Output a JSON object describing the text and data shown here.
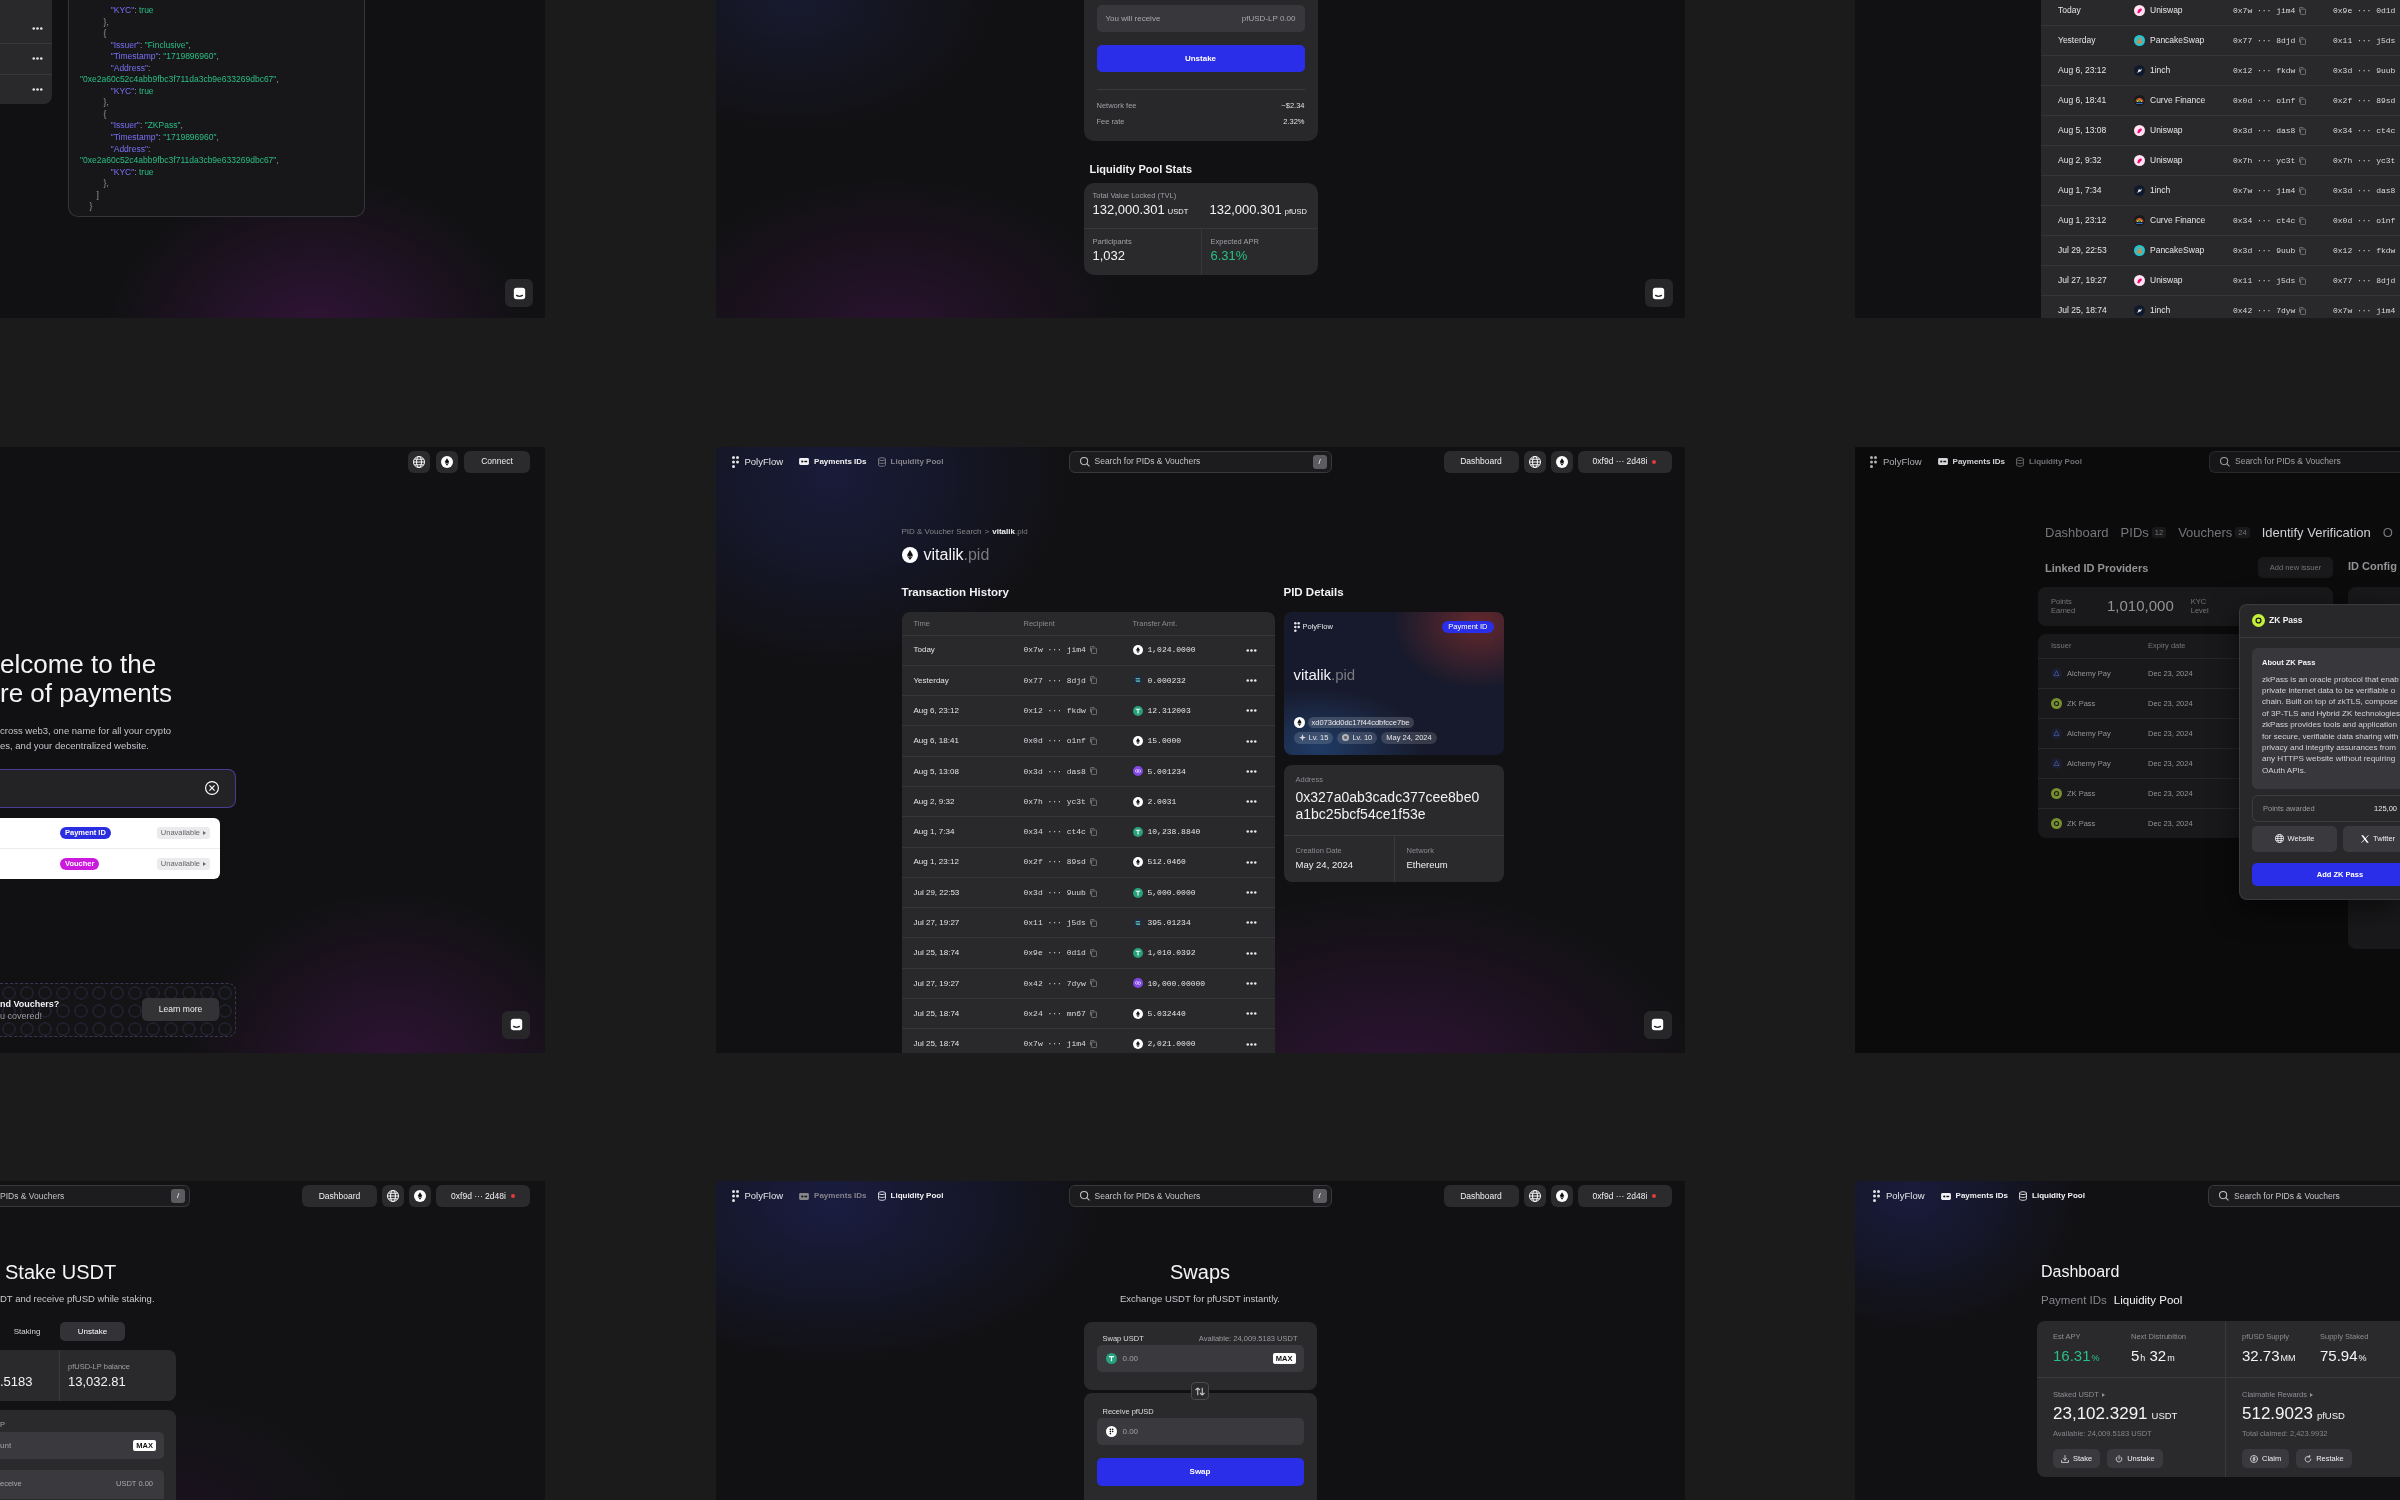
{
  "screens": [
    {
      "kind": "code-viewer",
      "code_lines": [
        "             \"KYC\": true",
        "          },",
        "          {",
        "             \"Issuer\": \"Finclusive\",",
        "             \"Timestamp\": \"1719896960\",",
        "             \"Address\":",
        "\"0xe2a60c52c4abb9fbc3f711da3cb9e633269dbc67\",",
        "             \"KYC\": true",
        "          },",
        "          {",
        "             \"Issuer\": \"ZKPass\",",
        "             \"Timestamp\": \"1719896960\",",
        "             \"Address\":",
        "\"0xe2a60c52c4abb9fbc3f711da3cb9e633269dbc67\",",
        "             \"KYC\": true",
        "          },",
        "       ]",
        "    }"
      ]
    },
    {
      "kind": "unstake",
      "receive": {
        "label": "You will receive",
        "amount": "pfUSD-LP 0.00"
      },
      "submit": "Unstake",
      "fees": [
        {
          "label": "Network fee",
          "value": "~$2.34"
        },
        {
          "label": "Fee rate",
          "value": "2.32%"
        }
      ],
      "stats_title": "Liquidity Pool Stats",
      "stats": [
        {
          "label": "Total Value Locked (TVL)",
          "value": "132,000.301",
          "unit": "USDT",
          "highlight": false
        },
        {
          "value": "132,000.301",
          "unit": "pfUSD",
          "highlight": false
        },
        {
          "label": "Participants",
          "value": "1,032",
          "highlight": false
        },
        {
          "label": "Expected APR",
          "value": "6.31%",
          "highlight": true
        }
      ]
    },
    {
      "kind": "swap-history",
      "rows": [
        {
          "column_1": "Today",
          "column_2": "Uniswap",
          "kind": "uniswap",
          "column_3": "0x7w ··· jim4",
          "column_4": "0x9e ··· 0d1d"
        },
        {
          "column_1": "Yesterday",
          "column_2": "PancakeSwap",
          "kind": "pancakeswap",
          "column_3": "0x77 ··· 8djd",
          "column_4": "0x11 ··· j5ds"
        },
        {
          "column_1": "Aug 6, 23:12",
          "column_2": "1inch",
          "kind": "oneinch",
          "column_3": "0x12 ··· fkdw",
          "column_4": "0x3d ··· 9uub"
        },
        {
          "column_1": "Aug 6, 18:41",
          "column_2": "Curve Finance",
          "kind": "curve",
          "column_3": "0x0d ··· o1nf",
          "column_4": "0x2f ··· 89sd"
        },
        {
          "column_1": "Aug 5, 13:08",
          "column_2": "Uniswap",
          "kind": "uniswap",
          "column_3": "0x3d ··· das8",
          "column_4": "0x34 ··· ct4c"
        },
        {
          "column_1": "Aug 2, 9:32",
          "column_2": "Uniswap",
          "kind": "uniswap",
          "column_3": "0x7h ··· yc3t",
          "column_4": "0x7h ··· yc3t"
        },
        {
          "column_1": "Aug 1, 7:34",
          "column_2": "1inch",
          "kind": "oneinch",
          "column_3": "0x7w ··· jim4",
          "column_4": "0x3d ··· das8"
        },
        {
          "column_1": "Aug 1, 23:12",
          "column_2": "Curve Finance",
          "kind": "curve",
          "column_3": "0x34 ··· ct4c",
          "column_4": "0x0d ··· o1nf"
        },
        {
          "column_1": "Jul 29, 22:53",
          "column_2": "PancakeSwap",
          "kind": "pancakeswap",
          "column_3": "0x3d ··· 9uub",
          "column_4": "0x12 ··· fkdw"
        },
        {
          "column_1": "Jul 27, 19:27",
          "column_2": "Uniswap",
          "kind": "uniswap",
          "column_3": "0x11 ··· j5ds",
          "column_4": "0x77 ··· 8djd"
        },
        {
          "column_1": "Jul 25, 18:74",
          "column_2": "1inch",
          "kind": "oneinch",
          "column_3": "0x42 ··· 7dyw",
          "column_4": "0x7w ··· jim4"
        }
      ]
    },
    {
      "kind": "landing",
      "connect_button": "Connect",
      "hero_title_lines": [
        "elcome to the",
        "re of payments"
      ],
      "hero_text_lines": [
        "cross web3, one name for all your crypto",
        "es, and your decentralized website."
      ],
      "results": [
        {
          "badge": "Payment ID",
          "color": "#2b2de0",
          "status": "Unavailable"
        },
        {
          "badge": "Voucher",
          "color": "#cc19dd",
          "status": "Unavailable"
        }
      ],
      "promo": {
        "title": "nd Vouchers?",
        "subtitle": "u covered!",
        "button": "Learn more"
      }
    },
    {
      "kind": "pid-detail",
      "nav": {
        "brand": "PolyFlow",
        "links": [
          {
            "label": "Payments IDs",
            "kind": "payment-ids",
            "selected": true
          },
          {
            "label": "Liquidity Pool",
            "kind": "liquidity-pool",
            "selected": false
          }
        ],
        "search": {
          "placeholder": "Search for PIDs & Vouchers",
          "shortcut": "/"
        },
        "dashboard_button": "Dashboard",
        "wallet": "0xf9d ··· 2d48i"
      },
      "breadcrumb": {
        "parent": "PID & Voucher Search",
        "separator": ">",
        "name": "vitalik",
        "suffix": ".pid"
      },
      "title": {
        "name": "vitalik",
        "suffix": ".pid"
      },
      "history": {
        "title": "Transaction History",
        "columns": [
          "Time",
          "Recipient",
          "Transfer Amt."
        ],
        "rows": [
          {
            "time": "Today",
            "recipient": "0x7w ··· jim4",
            "kind": "eth",
            "amount": "1,024.0000"
          },
          {
            "time": "Yesterday",
            "recipient": "0x77 ··· 8djd",
            "kind": "sol",
            "amount": "0.000232"
          },
          {
            "time": "Aug 6, 23:12",
            "recipient": "0x12 ··· fkdw",
            "kind": "usdt",
            "amount": "12.312003"
          },
          {
            "time": "Aug 6, 18:41",
            "recipient": "0x0d ··· o1nf",
            "kind": "eth",
            "amount": "15.0000"
          },
          {
            "time": "Aug 5, 13:08",
            "recipient": "0x3d ··· das8",
            "kind": "matic",
            "amount": "5.001234"
          },
          {
            "time": "Aug 2, 9:32",
            "recipient": "0x7h ··· yc3t",
            "kind": "eth",
            "amount": "2.0031"
          },
          {
            "time": "Aug 1, 7:34",
            "recipient": "0x34 ··· ct4c",
            "kind": "usdt",
            "amount": "10,238.8840"
          },
          {
            "time": "Aug 1, 23:12",
            "recipient": "0x2f ··· 89sd",
            "kind": "eth",
            "amount": "512.0460"
          },
          {
            "time": "Jul 29, 22:53",
            "recipient": "0x3d ··· 9uub",
            "kind": "usdt",
            "amount": "5,000.0000"
          },
          {
            "time": "Jul 27, 19:27",
            "recipient": "0x11 ··· j5ds",
            "kind": "sol",
            "amount": "395.01234"
          },
          {
            "time": "Jul 25, 18:74",
            "recipient": "0x9e ··· 0d1d",
            "kind": "usdt",
            "amount": "1,010.0392"
          },
          {
            "time": "Jul 27, 19:27",
            "recipient": "0x42 ··· 7dyw",
            "kind": "matic",
            "amount": "10,000.00000"
          },
          {
            "time": "Jul 25, 18:74",
            "recipient": "0x24 ··· mn67",
            "kind": "eth",
            "amount": "5.032440"
          },
          {
            "time": "Jul 25, 18:74",
            "recipient": "0x7w ··· jim4",
            "kind": "eth",
            "amount": "2,021.0000"
          }
        ]
      },
      "details": {
        "title": "PID Details",
        "card": {
          "brand": "PolyFlow",
          "badge": "Payment ID",
          "name": "vitalik",
          "suffix": ".pid",
          "address": "xd073dd0dc17f44cdbfcce7be",
          "chips": [
            {
              "kind": "sparkle",
              "label": "Lv. 15"
            },
            {
              "kind": "seal",
              "label": "Lv. 10"
            },
            {
              "kind": "date",
              "label": "May 24, 2024"
            }
          ]
        },
        "address_label": "Address",
        "address": "0x327a0ab3cadc377cee8be0a1bc25bcf54ce1f53e",
        "fields": [
          {
            "label": "Creation Date",
            "value": "May 24, 2024"
          },
          {
            "label": "Network",
            "value": "Ethereum"
          }
        ]
      }
    },
    {
      "kind": "id-verification",
      "nav": {
        "brand": "PolyFlow",
        "links": [
          {
            "label": "Payments IDs",
            "kind": "payment-ids",
            "selected": true
          },
          {
            "label": "Liquidity Pool",
            "kind": "liquidity-pool",
            "selected": false
          }
        ],
        "search": {
          "placeholder": "Search for PIDs & Vouchers"
        }
      },
      "tabs": [
        {
          "label": "Dashboard",
          "selected": false
        },
        {
          "label": "PIDs",
          "count": "12",
          "selected": false
        },
        {
          "label": "Vouchers",
          "count": "24",
          "selected": false
        },
        {
          "label": "Identify Verification",
          "selected": true
        },
        {
          "label": "O",
          "selected": false
        }
      ],
      "providers_title": "Linked ID Providers",
      "add_button": "Add new issuer",
      "config_title": "ID Config",
      "stats": [
        {
          "label": "Points Earned",
          "value": "1,010,000"
        },
        {
          "label": "KYC Level"
        }
      ],
      "columns": [
        "Issuer",
        "Expiry date"
      ],
      "issuers": [
        {
          "name": "Alchemy Pay",
          "kind": "alchemy",
          "expiry": "Dec 23, 2024"
        },
        {
          "name": "ZK Pass",
          "kind": "zkpass",
          "expiry": "Dec 23, 2024"
        },
        {
          "name": "Alchemy Pay",
          "kind": "alchemy",
          "expiry": "Dec 23, 2024"
        },
        {
          "name": "Alchemy Pay",
          "kind": "alchemy",
          "expiry": "Dec 23, 2024"
        },
        {
          "name": "ZK Pass",
          "kind": "zkpass",
          "expiry": "Dec 23, 2024"
        },
        {
          "name": "ZK Pass",
          "kind": "zkpass",
          "expiry": "Dec 23, 2024"
        }
      ],
      "modal": {
        "kind": "zkpass",
        "title": "ZK Pass",
        "about_title": "About ZK Pass",
        "about_lines": [
          "zkPass is an oracle protocol that enab",
          "private internet data to be verifiable o",
          "chain. Built on top of zkTLS, compose",
          "of 3P-TLS and Hybrid ZK technologies",
          "zkPass provides tools and application",
          "for secure, verifiable data sharing with",
          "privacy and integrity assurances from",
          "any HTTPS website without requiring",
          "OAuth APIs."
        ],
        "points_label": "Points awarded",
        "points_value": "125,00",
        "links": [
          {
            "label": "Website",
            "kind": "website"
          },
          {
            "label": "Twitter",
            "kind": "twitter"
          }
        ],
        "primary_button": "Add ZK Pass"
      }
    },
    {
      "kind": "stake",
      "nav": {
        "search": {
          "placeholder": "PIDs & Vouchers",
          "shortcut": "/"
        },
        "dashboard_button": "Dashboard",
        "wallet": "0xf9d ··· 2d48i"
      },
      "title": "Stake USDT",
      "subtitle": "DT and receive pfUSD while staking.",
      "tabs": [
        {
          "label": "Staking",
          "selected": false
        },
        {
          "label": "Unstake",
          "selected": true
        }
      ],
      "balances": [
        {
          "value": ".5183"
        },
        {
          "label": "pfUSD-LP balance",
          "value": "13,032.81"
        }
      ],
      "form": {
        "label": "P",
        "placeholder": "unt",
        "max": "MAX",
        "receive_label": "eceive",
        "receive_value": "USDT 0.00"
      }
    },
    {
      "kind": "swap",
      "nav": {
        "brand": "PolyFlow",
        "links": [
          {
            "label": "Payments IDs",
            "kind": "payment-ids",
            "selected": false
          },
          {
            "label": "Liquidity Pool",
            "kind": "liquidity-pool",
            "selected": true
          }
        ],
        "search": {
          "placeholder": "Search for PIDs & Vouchers",
          "shortcut": "/"
        },
        "dashboard_button": "Dashboard",
        "wallet": "0xf9d ··· 2d48i"
      },
      "title": "Swaps",
      "subtitle": "Exchange USDT for pfUSDT instantly.",
      "from": {
        "label": "Swap USDT",
        "available": "Available: 24,009.5183 USDT",
        "kind": "usdt",
        "placeholder": "0.00",
        "max": "MAX"
      },
      "to": {
        "label": "Receive pfUSD",
        "kind": "pfusd",
        "placeholder": "0.00"
      },
      "submit": "Swap"
    },
    {
      "kind": "dashboard",
      "nav": {
        "brand": "PolyFlow",
        "links": [
          {
            "label": "Payments IDs",
            "kind": "payment-ids",
            "selected": true
          },
          {
            "label": "Liquidity Pool",
            "kind": "liquidity-pool",
            "selected": true
          }
        ],
        "search": {
          "placeholder": "Search for PIDs & Vouchers"
        }
      },
      "title": "Dashboard",
      "tabs": [
        {
          "label": "Payment IDs",
          "selected": false
        },
        {
          "label": "Liquidity Pool",
          "selected": true
        }
      ],
      "summary_groups": [
        {
          "stats": [
            {
              "label": "Est APY",
              "parts": [
                {
                  "number": "16.31",
                  "unit": "%"
                }
              ],
              "highlight": true
            },
            {
              "label": "Next Distrubition",
              "parts": [
                {
                  "number": "5",
                  "unit": "h"
                },
                {
                  "number": "32",
                  "unit": "m"
                }
              ],
              "highlight": false
            }
          ]
        },
        {
          "stats": [
            {
              "label": "pfUSD Supply",
              "parts": [
                {
                  "number": "32.73",
                  "unit": "MM"
                }
              ],
              "highlight": false
            },
            {
              "label": "Supply Staked",
              "parts": [
                {
                  "number": "75.94",
                  "unit": "%"
                }
              ],
              "highlight": false
            }
          ]
        }
      ],
      "balances": [
        {
          "label": "Staked USDT",
          "parts": [
            {
              "number": "23,102.3291",
              "unit": "USDT"
            }
          ],
          "note": "Available: 24,009.5183 USDT",
          "actions": [
            {
              "label": "Stake",
              "kind": "stake"
            },
            {
              "label": "Unstake",
              "kind": "unstake"
            }
          ]
        },
        {
          "label": "Claimable Rewards",
          "parts": [
            {
              "number": "512.9023",
              "unit": "pfUSD"
            }
          ],
          "note": "Total claimed: 2,423.9932",
          "actions": [
            {
              "label": "Claim",
              "kind": "claim"
            },
            {
              "label": "Restake",
              "kind": "restake"
            }
          ]
        }
      ]
    }
  ]
}
